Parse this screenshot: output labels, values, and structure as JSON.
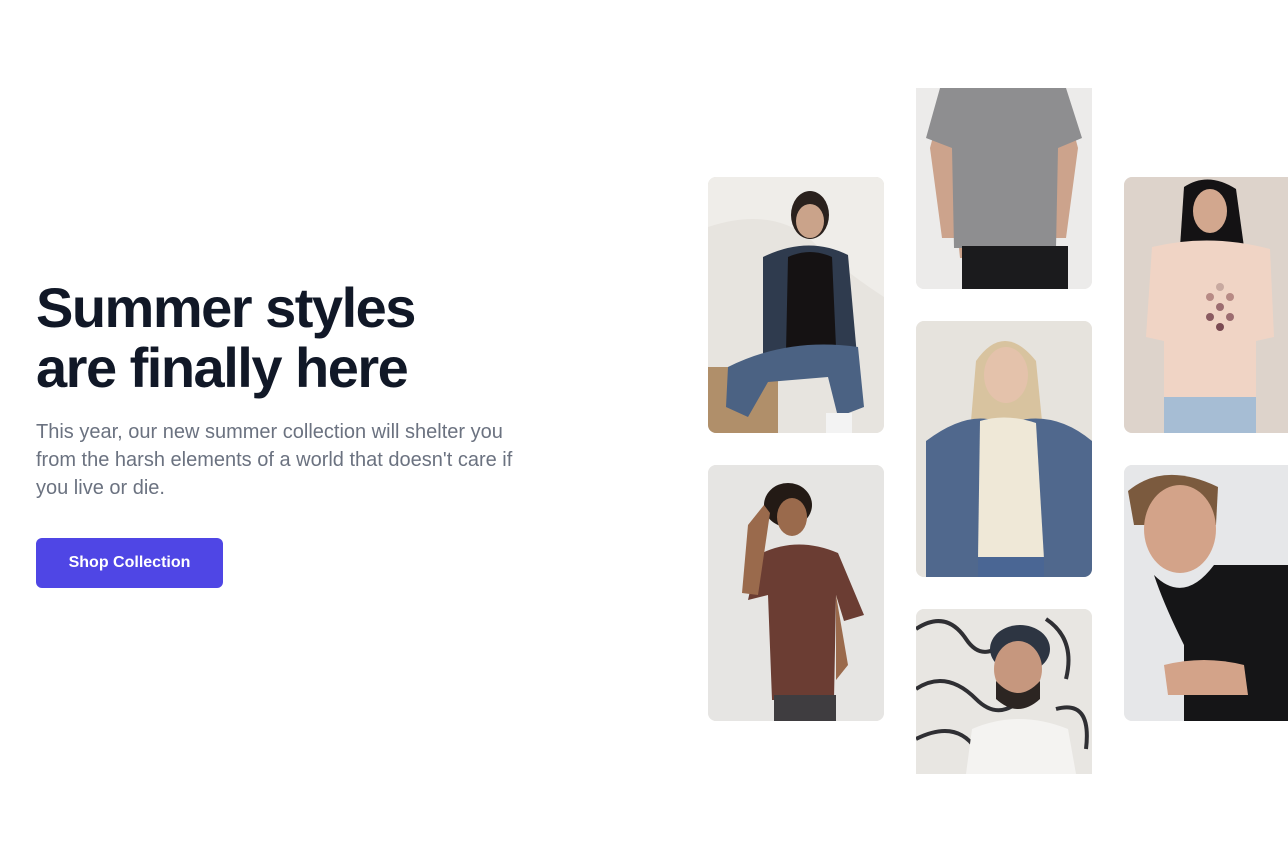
{
  "hero": {
    "title": "Summer styles are finally here",
    "subtitle": "This year, our new summer collection will shelter you from the harsh elements of a world that doesn't care if you live or die.",
    "cta_label": "Shop Collection"
  },
  "colors": {
    "title": "#111827",
    "subtitle": "#6b7280",
    "cta_background": "#4f46e5",
    "cta_text": "#ffffff",
    "page_background": "#ffffff"
  },
  "gallery": {
    "images": [
      {
        "name": "woman-denim-jacket-black-tee-photo"
      },
      {
        "name": "man-brown-tee-photo"
      },
      {
        "name": "grey-tee-torso-photo"
      },
      {
        "name": "blonde-woman-denim-jacket-photo"
      },
      {
        "name": "man-beanie-glasses-photo"
      },
      {
        "name": "woman-pink-graphic-tee-photo"
      },
      {
        "name": "man-black-tee-photo"
      }
    ]
  }
}
